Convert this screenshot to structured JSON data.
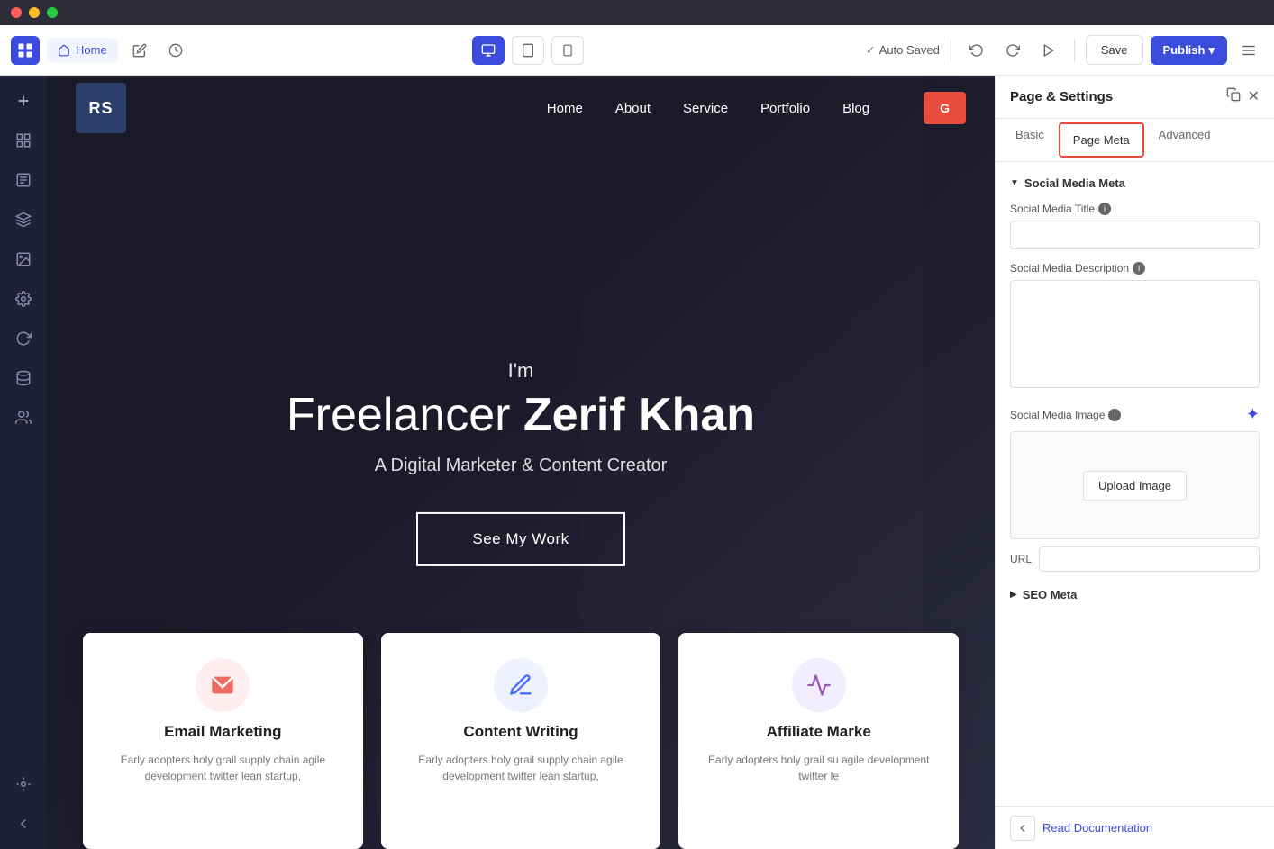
{
  "titlebar": {
    "traffic_lights": [
      "red",
      "yellow",
      "green"
    ]
  },
  "toolbar": {
    "home_tab": "Home",
    "auto_saved_text": "Auto Saved",
    "save_label": "Save",
    "publish_label": "Publish",
    "publish_arrow": "▾",
    "device_desktop": "🖥",
    "device_tablet": "⬜",
    "device_mobile": "📱",
    "undo_icon": "↩",
    "redo_icon": "↪",
    "play_icon": "▶",
    "menu_icon": "≡"
  },
  "sidebar": {
    "icons": [
      {
        "name": "add-icon",
        "glyph": "+"
      },
      {
        "name": "grid-icon",
        "glyph": "⊞"
      },
      {
        "name": "page-icon",
        "glyph": "☰"
      },
      {
        "name": "layers-icon",
        "glyph": "⧉"
      },
      {
        "name": "image-icon",
        "glyph": "🖼"
      },
      {
        "name": "settings-icon",
        "glyph": "⚙"
      },
      {
        "name": "refresh-icon",
        "glyph": "↺"
      },
      {
        "name": "database-icon",
        "glyph": "⬤"
      },
      {
        "name": "people-icon",
        "glyph": "👥"
      },
      {
        "name": "integration-icon",
        "glyph": "✳"
      },
      {
        "name": "help-icon",
        "glyph": "?"
      },
      {
        "name": "back-icon",
        "glyph": "←"
      }
    ]
  },
  "website": {
    "logo_text": "RS",
    "nav_links": [
      "Home",
      "About",
      "Service",
      "Portfolio",
      "Blog"
    ],
    "nav_cta": "G",
    "hero_subtitle": "I'm",
    "hero_title_regular": "Freelancer ",
    "hero_title_bold": "Zerif Khan",
    "hero_description": "A Digital Marketer & Content Creator",
    "hero_cta": "See My Work",
    "cards": [
      {
        "icon": "📧",
        "icon_color": "pink",
        "title": "Email Marketing",
        "text": "Early adopters holy grail supply chain agile development twitter lean startup,"
      },
      {
        "icon": "✍",
        "icon_color": "blue",
        "title": "Content Writing",
        "text": "Early adopters holy grail supply chain agile development twitter lean startup,"
      },
      {
        "icon": "📣",
        "icon_color": "purple",
        "title": "Affiliate Marke",
        "text": "Early adopters holy grail su agile development twitter le"
      }
    ]
  },
  "panel": {
    "title": "Page & Settings",
    "tabs": [
      {
        "label": "Basic",
        "id": "basic"
      },
      {
        "label": "Page Meta",
        "id": "page-meta",
        "active": true,
        "outlined": true
      },
      {
        "label": "Advanced",
        "id": "advanced"
      }
    ],
    "social_media_section": "Social Media Meta",
    "social_title_label": "Social Media Title",
    "social_title_info": "i",
    "social_desc_label": "Social Media Description",
    "social_desc_info": "i",
    "social_image_label": "Social Media Image",
    "social_image_info": "i",
    "upload_image_btn": "Upload Image",
    "url_label": "URL",
    "seo_section": "SEO Meta",
    "read_docs_label": "Read Documentation"
  }
}
